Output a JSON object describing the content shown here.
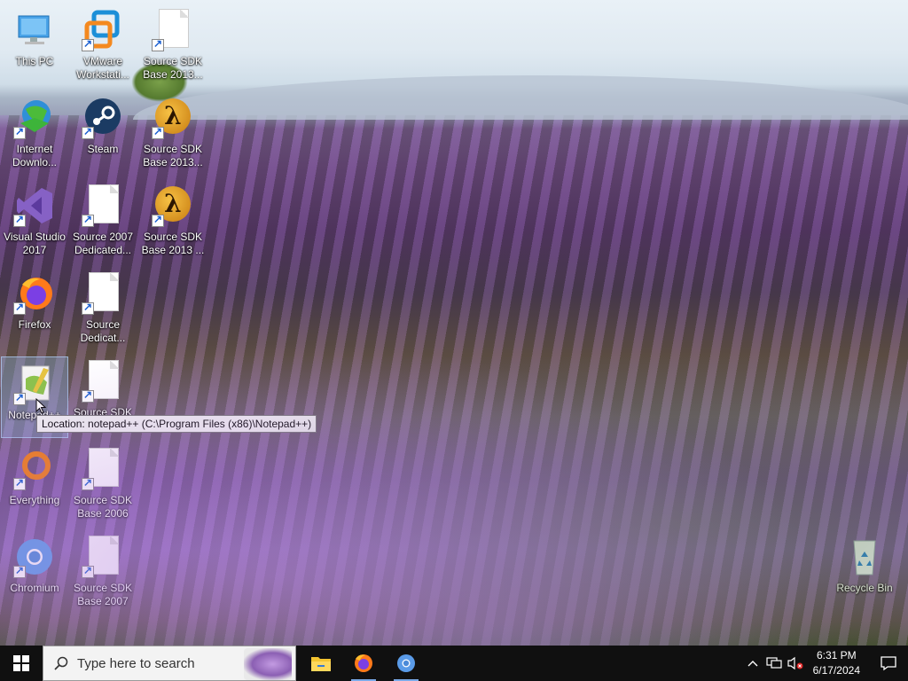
{
  "desktop": {
    "icons": [
      {
        "label": "This PC"
      },
      {
        "label": "VMware Workstati..."
      },
      {
        "label": "Source SDK Base 2013..."
      },
      {
        "label": "Internet Downlo..."
      },
      {
        "label": "Steam"
      },
      {
        "label": "Source SDK Base 2013..."
      },
      {
        "label": "Visual Studio 2017"
      },
      {
        "label": "Source 2007 Dedicated..."
      },
      {
        "label": "Source SDK Base 2013 ..."
      },
      {
        "label": "Firefox"
      },
      {
        "label": "Source Dedicat..."
      },
      {
        "label": "Notepad++"
      },
      {
        "label": "Source SDK"
      },
      {
        "label": "Everything"
      },
      {
        "label": "Source SDK Base 2006"
      },
      {
        "label": "Chromium"
      },
      {
        "label": "Source SDK Base 2007"
      },
      {
        "label": "Recycle Bin"
      }
    ],
    "tooltip": "Location: notepad++ (C:\\Program Files (x86)\\Notepad++)"
  },
  "taskbar": {
    "search_placeholder": "Type here to search",
    "pinned": [
      "File Explorer",
      "Firefox",
      "Chromium"
    ],
    "clock": {
      "time": "6:31 PM",
      "date": "6/17/2024"
    }
  }
}
